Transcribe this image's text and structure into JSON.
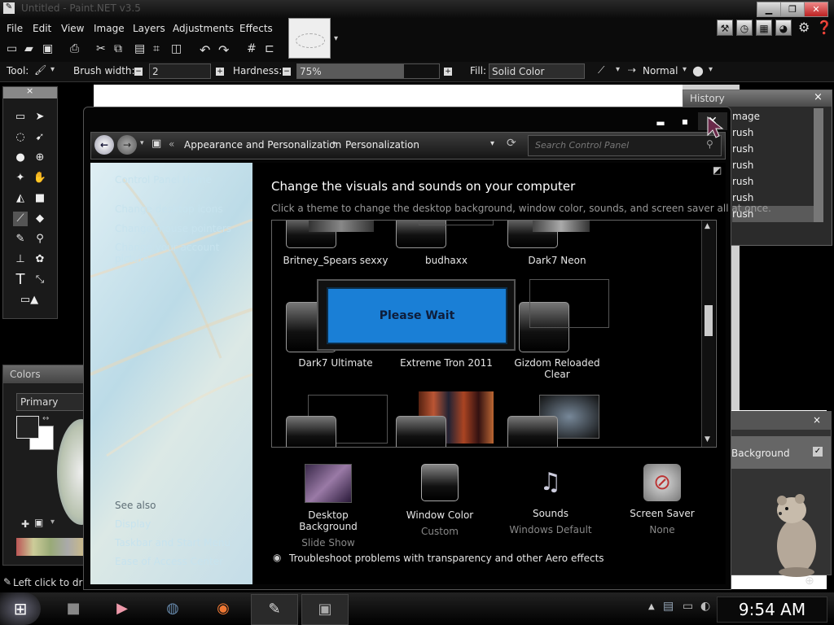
{
  "pdn": {
    "window_title": "Untitled - Paint.NET v3.5",
    "menu": [
      "File",
      "Edit",
      "View",
      "Image",
      "Layers",
      "Adjustments",
      "Effects"
    ],
    "toolbar": {
      "tool_label": "Tool:",
      "brush_width_label": "Brush width:",
      "brush_width_value": "2",
      "hardness_label": "Hardness:",
      "hardness_value": "75%",
      "hardness_fraction": 0.75,
      "fill_label": "Fill:",
      "fill_value": "Solid Color",
      "blend_mode": "Normal"
    },
    "history": {
      "title": "History",
      "close": "×",
      "items": [
        "mage",
        "rush",
        "rush",
        "rush",
        "rush",
        "rush",
        "rush"
      ]
    },
    "layers": {
      "close": "×",
      "item": "Background"
    },
    "colors": {
      "title": "Colors",
      "primary_label": "Primary"
    },
    "status": "Left click to draw"
  },
  "cp": {
    "breadcrumb": [
      "Appearance and Personalization",
      "Personalization"
    ],
    "breadcrumb_prefix": "«",
    "search_placeholder": "Search Control Panel",
    "left_links": [
      "Control Panel Home",
      "Change desktop icons",
      "Change mouse pointers",
      "Change your account picture"
    ],
    "see_also": {
      "label": "See also",
      "items": [
        "Display",
        "Taskbar and Start Menu",
        "Ease of Access Center"
      ]
    },
    "heading": "Change the visuals and sounds on your computer",
    "subheading": "Click a theme to change the desktop background, window color, sounds, and screen saver all at once.",
    "themes_row1": [
      "Britney_Spears sexxy",
      "budhaxx",
      "Dark7 Neon"
    ],
    "themes_row2": [
      "Dark7 Ultimate",
      "Extreme Tron 2011",
      "Gizdom Reloaded Clear"
    ],
    "please_wait": "Please Wait",
    "bottom": [
      {
        "title": "Desktop Background",
        "sub": "Slide Show",
        "icon": "desktop-background-icon"
      },
      {
        "title": "Window Color",
        "sub": "Custom",
        "icon": "window-color-icon"
      },
      {
        "title": "Sounds",
        "sub": "Windows Default",
        "icon": "sounds-icon"
      },
      {
        "title": "Screen Saver",
        "sub": "None",
        "icon": "screen-saver-icon"
      }
    ],
    "troubleshoot": "Troubleshoot problems with transparency and other Aero effects"
  },
  "taskbar": {
    "clock": "9:54 AM"
  }
}
